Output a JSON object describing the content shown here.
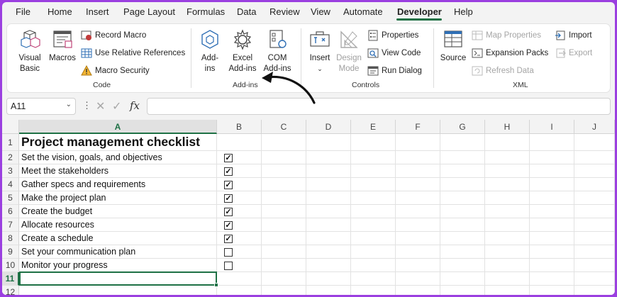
{
  "menu": {
    "items": [
      "File",
      "Home",
      "Insert",
      "Page Layout",
      "Formulas",
      "Data",
      "Review",
      "View",
      "Automate",
      "Developer",
      "Help"
    ],
    "active": "Developer"
  },
  "ribbon": {
    "code": {
      "label": "Code",
      "visual_basic": "Visual Basic",
      "macros": "Macros",
      "record_macro": "Record Macro",
      "use_relative_references": "Use Relative References",
      "macro_security": "Macro Security"
    },
    "addins": {
      "label": "Add-ins",
      "addins": "Add-ins",
      "excel_addins": "Excel Add-ins",
      "com_addins": "COM Add-ins"
    },
    "controls": {
      "label": "Controls",
      "insert": "Insert",
      "design_mode": "Design Mode",
      "properties": "Properties",
      "view_code": "View Code",
      "run_dialog": "Run Dialog"
    },
    "xml": {
      "label": "XML",
      "source": "Source",
      "map_properties": "Map Properties",
      "expansion_packs": "Expansion Packs",
      "refresh_data": "Refresh Data",
      "import": "Import",
      "export": "Export"
    }
  },
  "formula_bar": {
    "name_box": "A11",
    "fx": "fx",
    "content": ""
  },
  "sheet": {
    "columns": [
      "A",
      "B",
      "C",
      "D",
      "E",
      "F",
      "G",
      "H",
      "I",
      "J"
    ],
    "selected_column": "A",
    "rows": [
      "1",
      "2",
      "3",
      "4",
      "5",
      "6",
      "7",
      "8",
      "9",
      "10",
      "11",
      "12"
    ],
    "selected_row": "11",
    "title": "Project management checklist",
    "tasks": [
      {
        "text": "Set the vision, goals, and objectives",
        "checked": true
      },
      {
        "text": "Meet the stakeholders",
        "checked": true
      },
      {
        "text": "Gather specs and requirements",
        "checked": true
      },
      {
        "text": "Make the project plan",
        "checked": true
      },
      {
        "text": "Create the budget",
        "checked": true
      },
      {
        "text": "Allocate resources",
        "checked": true
      },
      {
        "text": "Create a schedule",
        "checked": true
      },
      {
        "text": "Set your communication plan",
        "checked": false
      },
      {
        "text": "Monitor your progress",
        "checked": false
      }
    ]
  },
  "colors": {
    "accent": "#1e7145",
    "frame": "#9b3fe0"
  }
}
